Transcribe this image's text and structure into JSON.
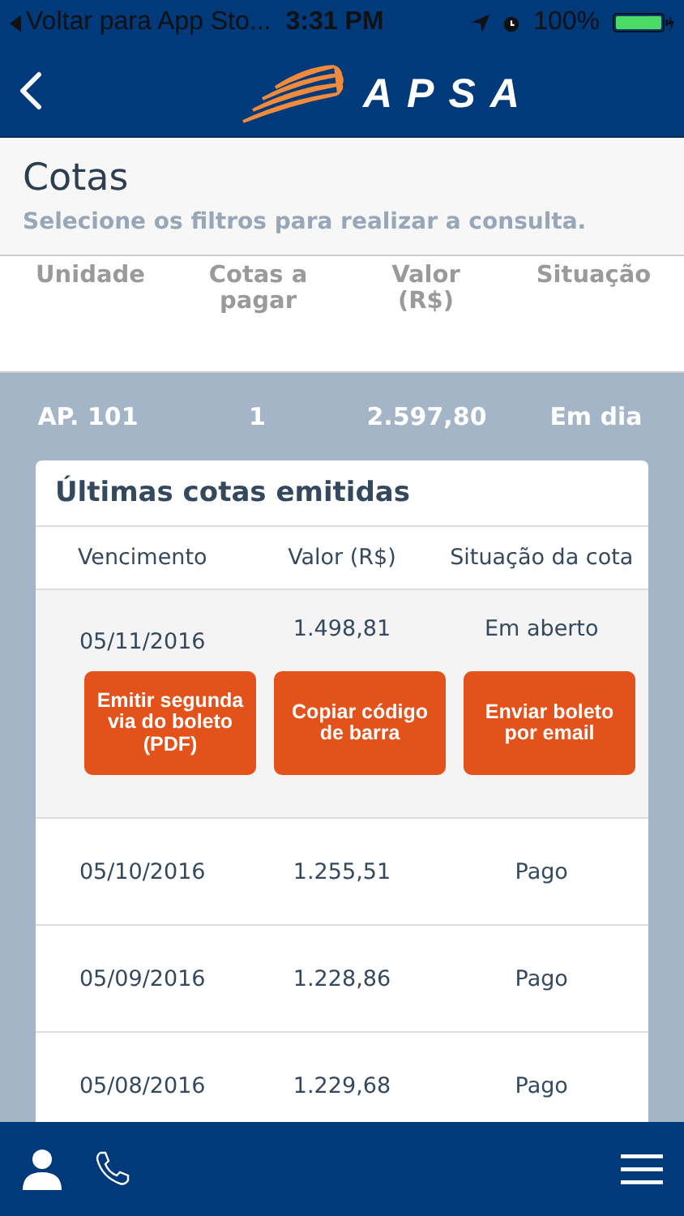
{
  "status_bar": {
    "back_label": "Voltar para App Sto...",
    "time": "3:31 PM",
    "battery": "100%"
  },
  "nav": {
    "brand": "APSA"
  },
  "header": {
    "title": "Cotas",
    "subtitle": "Selecione os filtros para realizar a consulta."
  },
  "summary": {
    "columns": [
      "Unidade",
      "Cotas a pagar",
      "Valor (R$)",
      "Situação"
    ],
    "row": [
      "AP. 101",
      "1",
      "2.597,80",
      "Em dia"
    ]
  },
  "card": {
    "title": "Últimas cotas emitidas",
    "columns": [
      "Vencimento",
      "Valor (R$)",
      "Situação da cota"
    ],
    "rows": [
      {
        "due": "05/11/2016",
        "value": "1.498,81",
        "status": "Em aberto",
        "expanded": true,
        "actions": [
          "Emitir segunda via do boleto (PDF)",
          "Copiar código de barra",
          "Enviar boleto por email"
        ]
      },
      {
        "due": "05/10/2016",
        "value": "1.255,51",
        "status": "Pago",
        "expanded": false,
        "actions": []
      },
      {
        "due": "05/09/2016",
        "value": "1.228,86",
        "status": "Pago",
        "expanded": false,
        "actions": []
      },
      {
        "due": "05/08/2016",
        "value": "1.229,68",
        "status": "Pago",
        "expanded": false,
        "actions": []
      }
    ]
  }
}
